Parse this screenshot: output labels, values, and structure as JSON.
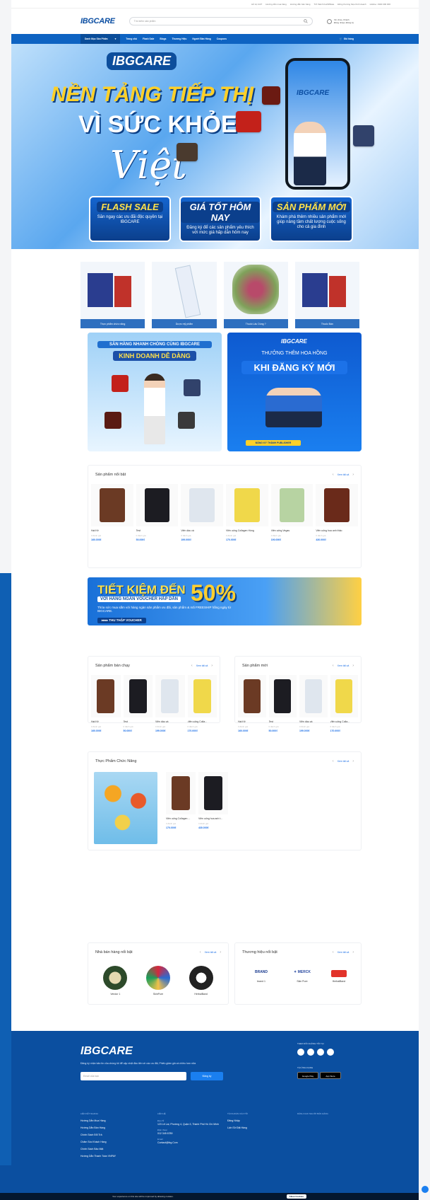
{
  "topbar": {
    "items": [
      "Hỗ trợ 24/7",
      "Hướng dẫn mua hàng",
      "Hướng dẫn bán hàng",
      "Trở thành Kol/Affiliate",
      "Đồng thương hiệu Kinh doanh",
      "Hotline: 1900 000 000"
    ]
  },
  "header": {
    "logo": "IBGCARE",
    "search_placeholder": "Tìm kiếm sản phẩm",
    "account_line1": "Xin chào, Khách",
    "account_line2": "Đăng nhập | Đăng ký"
  },
  "nav": {
    "category_label": "Danh Mục Sản Phẩm",
    "items": [
      "Trang chủ",
      "Flash Sale",
      "Blogs",
      "Thương Hiệu",
      "Người Bán Hàng",
      "Coupons"
    ],
    "cart": "Giỏ hàng"
  },
  "hero": {
    "logo": "IBGCARE",
    "line1": "NỀN TẢNG TIẾP THỊ",
    "line2": "VÌ SỨC KHỎE",
    "line3": "Việt",
    "promos": [
      {
        "title": "FLASH SALE",
        "desc": "Săn ngay các ưu đãi độc quyền tại IBGCARE"
      },
      {
        "title": "GIÁ TỐT HÔM NAY",
        "desc": "Đăng ký để các sản phẩm yêu thích với mức giá hấp dẫn hôm nay"
      },
      {
        "title": "SẢN PHẨM MỚI",
        "desc": "Khám phá thêm nhiều sản phẩm mới giúp nâng tầm chất lượng cuộc sống cho cả gia đình"
      }
    ]
  },
  "categories": [
    {
      "label": "Thực phẩm chức năng"
    },
    {
      "label": "Dược mỹ phẩm"
    },
    {
      "label": "Thuốc Lâu Dùng ?"
    },
    {
      "label": "Thuốc Bán"
    }
  ],
  "banners": {
    "left_title": "SĂN HÀNG NHANH CHÓNG CÙNG IBGCARE",
    "left_sub": "KINH DOANH DỄ DÀNG",
    "right_logo": "IBGCARE",
    "right_title": "THƯỞNG THÊM HOA HỒNG",
    "right_sub": "KHI ĐĂNG KÝ MỚI",
    "right_cta": "ĐĂNG KÝ THÀNH PUBLISHER"
  },
  "featured": {
    "title": "Sản phẩm nổi bật",
    "view_all": "Xem tất cả",
    "products": [
      {
        "name": "Hạt Kê",
        "rating": "0 đánh giá",
        "price": "160.000₫"
      },
      {
        "name": "Test",
        "rating": "0 đánh giá",
        "price": "50.000₫"
      },
      {
        "name": "Viên dầu cá",
        "rating": "0 đánh giá",
        "price": "199.000₫"
      },
      {
        "name": "Viên uống Collagen Hồng",
        "rating": "0 đánh giá",
        "price": "170.000₫"
      },
      {
        "name": "Viên uống Vegas",
        "rating": "0 đánh giá",
        "price": "190.000₫"
      },
      {
        "name": "Viên uống hoa anh thảo",
        "rating": "0 đánh giá",
        "price": "430.000₫"
      }
    ]
  },
  "voucher": {
    "title": "TIẾT KIỆM ĐẾN",
    "percent": "50%",
    "sub": "VỚI HÀNG NGÀN VOUCHER HẤP DẪN",
    "desc": "Thỏa sức mua sắm với hàng ngàn sản phẩm ưu đãi, sản phẩm & mã FREESHIP hằng ngày từ IBGCARE.",
    "button": "▸▸▸▸ THU THẬP VOUCHER"
  },
  "bestsellers": {
    "title": "Sản phẩm bán chạy",
    "view_all": "Xem tất cả",
    "products": [
      {
        "name": "Hạt Kê",
        "rating": "0 đánh giá",
        "price": "160.000₫"
      },
      {
        "name": "Test",
        "rating": "0 đánh giá",
        "price": "50.000₫"
      },
      {
        "name": "Viên dầu cá",
        "rating": "0 đánh giá",
        "price": "199.000₫"
      },
      {
        "name": "Viên uống Colla...",
        "rating": "0 đánh giá",
        "price": "170.000₫"
      }
    ]
  },
  "newproducts": {
    "title": "Sản phẩm mới",
    "view_all": "Xem tất cả",
    "products": [
      {
        "name": "Hạt Kê",
        "rating": "0 đánh giá",
        "price": "160.000₫"
      },
      {
        "name": "Test",
        "rating": "0 đánh giá",
        "price": "50.000₫"
      },
      {
        "name": "Viên dầu cá",
        "rating": "0 đánh giá",
        "price": "199.000₫"
      },
      {
        "name": "Viên uống Colla...",
        "rating": "0 đánh giá",
        "price": "170.000₫"
      }
    ]
  },
  "functional": {
    "title": "Thực Phẩm Chức Năng",
    "view_all": "Xem tất cả",
    "products": [
      {
        "name": "Viên uống Collagen ...",
        "rating": "0 đánh giá",
        "price": "170.000₫"
      },
      {
        "name": "Viên uống hoa anh t...",
        "rating": "0 đánh giá",
        "price": "430.000₫"
      }
    ]
  },
  "sellers": {
    "title": "Nhà bán hàng nổi bật",
    "view_all": "Xem tất cả",
    "items": [
      {
        "name": "Vendor 1"
      },
      {
        "name": "SkinPure"
      },
      {
        "name": "HerbalBand"
      }
    ]
  },
  "brands": {
    "title": "Thương hiệu nổi bật",
    "view_all": "Xem tất cả",
    "items": [
      {
        "name": "brand 1"
      },
      {
        "name": "Skin Pure"
      },
      {
        "name": "HerbalBand"
      }
    ]
  },
  "footer": {
    "logo": "IBGCARE",
    "desc": "Đăng ký nhận bản tin của chúng tôi để cập nhật đầu tiên về các ưu đãi, Phiếu giảm giá và nhiều hơn nữa",
    "email_placeholder": "Email của bạn",
    "subscribe": "Đăng ký",
    "social_title": "THEO DÕI CHÚNG TÔI TẠI",
    "app_title": "TẢI ỨNG DỤNG",
    "google_play": "Google Play",
    "app_store": "App Store",
    "col1_title": "LIÊN KẾT NHANH",
    "col1": [
      "Hướng Dẫn Mua Hàng",
      "Hướng Dẫn Bán Hàng",
      "Chính Sách Đổi Trả",
      "Chăm Sóc Khách Hàng",
      "Chính Sách Bảo Mật",
      "Hướng Dẫn Thanh Toán VNPAY"
    ],
    "col2_title": "LIÊN HỆ",
    "address_label": "Địa chỉ",
    "address": "123 Lê Lai, Phường 4, Quận 3, Thành Phố Hồ Chí Minh",
    "phone_label": "Điện thoại",
    "phone": "012 345 6789",
    "email_label": "Email",
    "email": "Contact@ibg.Com",
    "col3_title": "TÀI KHOẢN CỦA TÔI",
    "col3": [
      "Đăng Nhập",
      "Lịch Sử Đặt Hàng"
    ],
    "col4_title": "DÀNH CHO NGƯỜI BÁN HÀNG"
  },
  "cookie": {
    "text": "Your experience on this site will be improved by allowing cookies.",
    "button": "Allow Cookies"
  },
  "colors": {
    "primary": "#0e63c2",
    "footer": "#0b4fa0",
    "accent": "#ffd028"
  }
}
